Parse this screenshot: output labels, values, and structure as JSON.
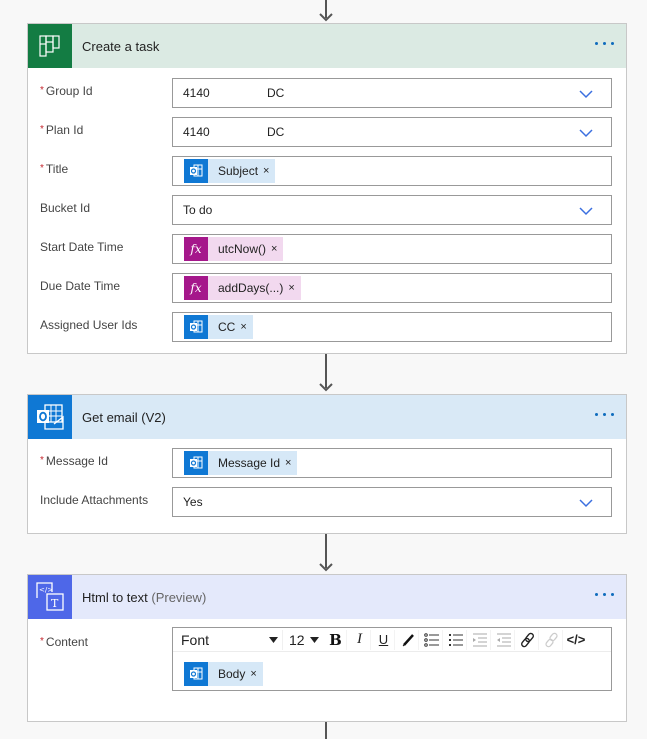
{
  "cards": {
    "create_task": {
      "title": "Create a task",
      "header_bg": "#dbeae3",
      "icon_bg": "#137c43",
      "icon": "planner-icon",
      "fields": {
        "group_id": {
          "label": "Group Id",
          "required": true,
          "value_a": "4140",
          "value_b": "DC",
          "type": "dropdown"
        },
        "plan_id": {
          "label": "Plan Id",
          "required": true,
          "value_a": "4140",
          "value_b": "DC",
          "type": "dropdown"
        },
        "title": {
          "label": "Title",
          "required": true,
          "token": {
            "text": "Subject",
            "kind": "outlook"
          }
        },
        "bucket_id": {
          "label": "Bucket Id",
          "required": false,
          "value": "To do",
          "type": "dropdown"
        },
        "start_date": {
          "label": "Start Date Time",
          "required": false,
          "token": {
            "text": "utcNow()",
            "kind": "expression"
          }
        },
        "due_date": {
          "label": "Due Date Time",
          "required": false,
          "token": {
            "text": "addDays(...)",
            "kind": "expression"
          }
        },
        "assigned_users": {
          "label": "Assigned User Ids",
          "required": false,
          "token": {
            "text": "CC",
            "kind": "outlook"
          }
        }
      }
    },
    "get_email": {
      "title": "Get email (V2)",
      "header_bg": "#d9e9f6",
      "icon_bg": "#0f78d4",
      "icon": "outlook-icon",
      "fields": {
        "message_id": {
          "label": "Message Id",
          "required": true,
          "token": {
            "text": "Message Id",
            "kind": "outlook"
          }
        },
        "include_attachments": {
          "label": "Include Attachments",
          "required": false,
          "value": "Yes",
          "type": "dropdown"
        }
      }
    },
    "html_to_text": {
      "title": "Html to text",
      "title_suffix": "(Preview)",
      "header_bg": "#e4e9fb",
      "icon_bg": "#4e67e8",
      "icon": "html-to-text-icon",
      "fields": {
        "content": {
          "label": "Content",
          "required": true,
          "toolbar": {
            "font": "Font",
            "size": "12"
          },
          "token": {
            "text": "Body",
            "kind": "outlook"
          }
        }
      }
    }
  },
  "symbols": {
    "required": "*",
    "remove": "×",
    "expr": "fx"
  },
  "colors": {
    "accent": "#0f6cbd",
    "required": "#c4262e"
  }
}
